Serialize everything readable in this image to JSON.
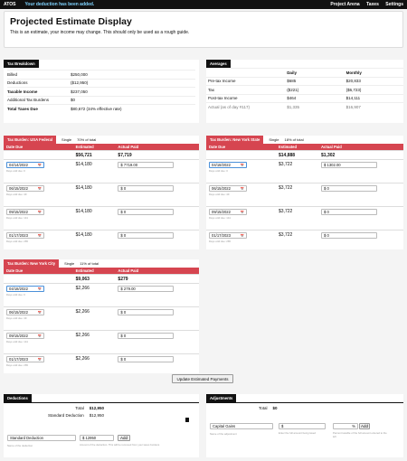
{
  "topbar": {
    "brand": "ATOS",
    "notice": "Your deduction has been added.",
    "nav": [
      "Project Arena",
      "Taxes",
      "Settings"
    ]
  },
  "hero": {
    "title": "Projected Estimate Display",
    "subtitle": "This is an estimate, your income may change. This should only be used as a rough guide."
  },
  "breakdown": {
    "tab": "Tax Breakdown",
    "rows": [
      {
        "label": "Billed",
        "value": "$250,000",
        "bold": false
      },
      {
        "label": "Deductions",
        "value": "($12,950)",
        "bold": false
      },
      {
        "label": "Taxable Income",
        "value": "$237,050",
        "bold": true
      },
      {
        "label": "Additional Tax Burdens",
        "value": "$0",
        "bold": false
      },
      {
        "label": "Total Taxes Due",
        "value": "$80,672 (34% effective rate)",
        "bold": true
      }
    ]
  },
  "averages": {
    "tab": "Averages",
    "headers": [
      "",
      "Daily",
      "Monthly"
    ],
    "rows": [
      [
        "Pre-tax Income",
        "$685",
        "$20,833"
      ],
      [
        "Tax",
        "($221)",
        "($6,723)"
      ],
      [
        "Post-tax Income",
        "$464",
        "$14,111"
      ],
      [
        "Actual (as of day #117)",
        "$1,335",
        "$16,907"
      ]
    ]
  },
  "federal": {
    "tab": "Tax Burden: USA Federal",
    "status": "Single",
    "pct": "70% of total",
    "headers": [
      "Date Due",
      "Estimated",
      "Actual Paid"
    ],
    "total_est": "$56,721",
    "total_paid": "$7,719",
    "rows": [
      {
        "date": "04/14/2022",
        "hint": "Days until due: 0",
        "est": "$14,180",
        "paid": "$ 7719.00",
        "focus": true
      },
      {
        "date": "06/15/2022",
        "hint": "Days until due: 49",
        "est": "$14,180",
        "paid": "$ 0",
        "focus": false
      },
      {
        "date": "09/15/2022",
        "hint": "Days until due: 141",
        "est": "$14,180",
        "paid": "$ 0",
        "focus": false
      },
      {
        "date": "01/17/2023",
        "hint": "Days until due: 265",
        "est": "$14,180",
        "paid": "$ 0",
        "focus": false
      }
    ]
  },
  "nys": {
    "tab": "Tax Burden: New York State",
    "status": "Single",
    "pct": "18% of total",
    "headers": [
      "Date Due",
      "Estimated",
      "Actual Paid"
    ],
    "total_est": "$14,888",
    "total_paid": "$1,302",
    "rows": [
      {
        "date": "04/18/2022",
        "hint": "Days until due: 0",
        "est": "$3,722",
        "paid": "$ 1302.00",
        "focus": true
      },
      {
        "date": "06/15/2022",
        "hint": "Days until due: 49",
        "est": "$3,722",
        "paid": "$ 0",
        "focus": false
      },
      {
        "date": "09/15/2022",
        "hint": "Days until due: 141",
        "est": "$3,722",
        "paid": "$ 0",
        "focus": false
      },
      {
        "date": "01/17/2023",
        "hint": "Days until due: 265",
        "est": "$3,722",
        "paid": "$ 0",
        "focus": false
      }
    ]
  },
  "nyc": {
    "tab": "Tax Burden: New York City",
    "status": "Single",
    "pct": "11% of total",
    "headers": [
      "Date Due",
      "Estimated",
      "Actual Paid"
    ],
    "total_est": "$9,063",
    "total_paid": "$279",
    "rows": [
      {
        "date": "04/18/2022",
        "hint": "Days until due: 0",
        "est": "$2,266",
        "paid": "$ 279.00",
        "focus": true
      },
      {
        "date": "06/15/2022",
        "hint": "Days until due: 49",
        "est": "$2,266",
        "paid": "$ 0",
        "focus": false
      },
      {
        "date": "09/15/2022",
        "hint": "Days until due: 141",
        "est": "$2,266",
        "paid": "$ 0",
        "focus": false
      },
      {
        "date": "01/17/2023",
        "hint": "Days until due: 265",
        "est": "$2,266",
        "paid": "$ 0",
        "focus": false
      }
    ]
  },
  "update_button": "Update Estimated Payments",
  "deductions": {
    "tab": "Deductions",
    "total_label": "Total",
    "total_value": "$12,950",
    "item_label": "Standard Deduction",
    "item_value": "$12,950",
    "name_value": "Standard Deduction",
    "name_hint": "Name of the deduction",
    "amount_value": "$  12950",
    "amount_hint": "Amount of the deduction. This will be removed from your taxes burdens",
    "add": "Add"
  },
  "adjustments": {
    "tab": "Adjustments",
    "total_label": "Total",
    "total_value": "$0",
    "name_placeholder": "Capital Gains",
    "name_hint": "Name of the adjustment",
    "amount_value": "$",
    "amount_hint": "Enter the full amount being taxed",
    "pct_value": "%",
    "pct_hint": "Percent taxable of the full amount entered to the left",
    "add": "Add"
  }
}
